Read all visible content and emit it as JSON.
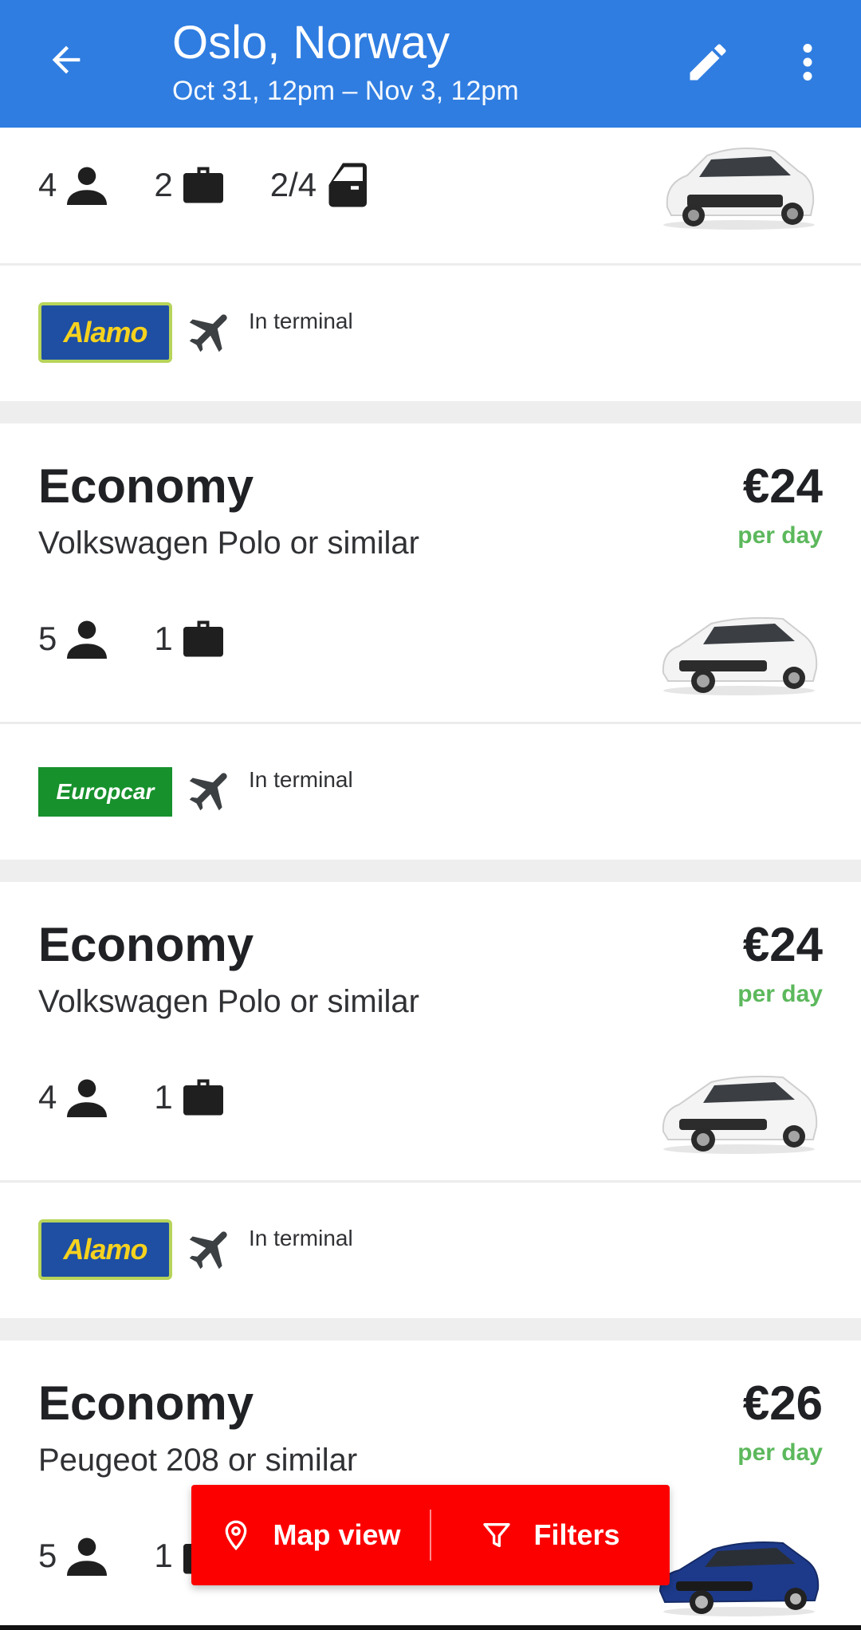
{
  "appbar": {
    "title": "Oslo, Norway",
    "subtitle": "Oct 31, 12pm – Nov 3, 12pm",
    "back_icon": "arrow-back-icon",
    "edit_icon": "pencil-icon",
    "more_icon": "more-vert-icon",
    "color": "#2f7de1"
  },
  "cards": [
    {
      "partial": true,
      "specs": {
        "seats": "4",
        "bags": "2",
        "doors": "2/4"
      },
      "vendor": "Alamo",
      "location": "In terminal"
    },
    {
      "category": "Economy",
      "model": "Volkswagen Polo or similar",
      "price": "€24",
      "per": "per day",
      "specs": {
        "seats": "5",
        "bags": "1"
      },
      "vendor": "Europcar",
      "location": "In terminal"
    },
    {
      "category": "Economy",
      "model": "Volkswagen Polo or similar",
      "price": "€24",
      "per": "per day",
      "specs": {
        "seats": "4",
        "bags": "1"
      },
      "vendor": "Alamo",
      "location": "In terminal"
    },
    {
      "category": "Economy",
      "model": "Peugeot 208 or similar",
      "price": "€26",
      "per": "per day",
      "specs": {
        "seats": "5",
        "bags": "1"
      }
    }
  ],
  "floating_bar": {
    "map_label": "Map view",
    "filters_label": "Filters",
    "color": "#fc0000"
  },
  "colors": {
    "price_green": "#5cb85c"
  }
}
